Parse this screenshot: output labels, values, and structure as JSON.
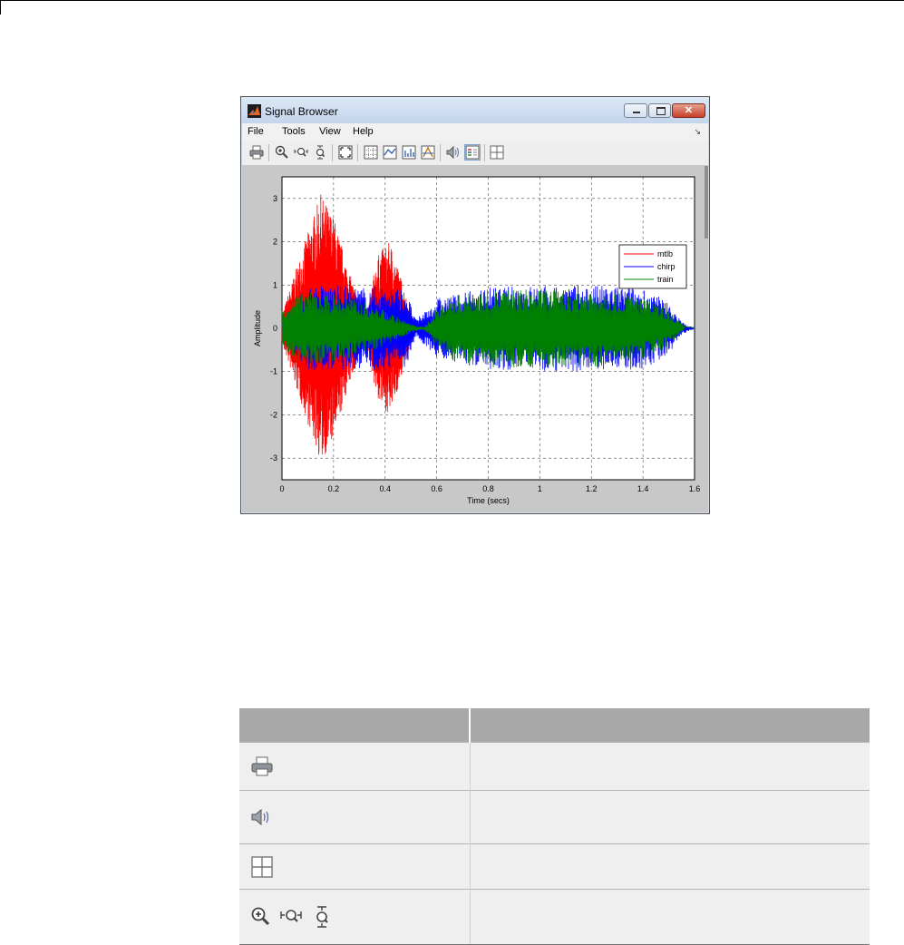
{
  "window": {
    "title": "Signal Browser",
    "menu": [
      "File",
      "Tools",
      "View",
      "Help"
    ],
    "toolbar_icons": [
      "print-icon",
      "zoom-in-icon",
      "zoom-x-icon",
      "zoom-y-icon",
      "autoscale-icon",
      "grid-icon",
      "line-plot-icon",
      "stem-plot-icon",
      "threshold-icon",
      "play-sound-icon",
      "legend-icon",
      "layout-icon"
    ]
  },
  "chart_data": {
    "type": "line",
    "xlabel": "Time (secs)",
    "ylabel": "Amplitude",
    "xlim": [
      0,
      1.6
    ],
    "ylim": [
      -3.5,
      3.5
    ],
    "xticks": [
      "0",
      "0.2",
      "0.4",
      "0.6",
      "0.8",
      "1",
      "1.2",
      "1.4",
      "1.6"
    ],
    "yticks": [
      "-3",
      "-2",
      "-1",
      "0",
      "1",
      "2",
      "3"
    ],
    "grid": true,
    "legend_position": "top-right",
    "series": [
      {
        "name": "mtlb",
        "color": "#ff0000",
        "envelope": [
          [
            0,
            0.3
          ],
          [
            0.05,
            1.3
          ],
          [
            0.1,
            2.2
          ],
          [
            0.15,
            3.1
          ],
          [
            0.2,
            2.6
          ],
          [
            0.25,
            1.5
          ],
          [
            0.3,
            0.6
          ],
          [
            0.33,
            0.3
          ],
          [
            0.36,
            1.4
          ],
          [
            0.38,
            1.8
          ],
          [
            0.42,
            2.0
          ],
          [
            0.44,
            1.6
          ],
          [
            0.47,
            1.0
          ],
          [
            0.5,
            0.3
          ],
          [
            0.52,
            0.1
          ],
          [
            0.55,
            0
          ]
        ]
      },
      {
        "name": "chirp",
        "color": "#0000ff",
        "envelope": [
          [
            0,
            0.2
          ],
          [
            0.1,
            1.0
          ],
          [
            0.2,
            1.0
          ],
          [
            0.3,
            0.95
          ],
          [
            0.4,
            1.0
          ],
          [
            0.48,
            0.9
          ],
          [
            0.52,
            0.2
          ],
          [
            0.6,
            0.7
          ],
          [
            0.8,
            0.95
          ],
          [
            1.0,
            1.0
          ],
          [
            1.2,
            1.0
          ],
          [
            1.4,
            0.95
          ],
          [
            1.5,
            0.6
          ],
          [
            1.55,
            0.15
          ],
          [
            1.6,
            0
          ]
        ]
      },
      {
        "name": "train",
        "color": "#008000",
        "envelope": [
          [
            0,
            0.5
          ],
          [
            0.05,
            0.75
          ],
          [
            0.1,
            0.85
          ],
          [
            0.2,
            0.8
          ],
          [
            0.3,
            0.65
          ],
          [
            0.4,
            0.42
          ],
          [
            0.5,
            0.1
          ],
          [
            0.55,
            0.02
          ],
          [
            0.6,
            0.45
          ],
          [
            0.65,
            0.75
          ],
          [
            0.8,
            0.9
          ],
          [
            1.0,
            0.92
          ],
          [
            1.2,
            0.9
          ],
          [
            1.35,
            0.82
          ],
          [
            1.45,
            0.6
          ],
          [
            1.52,
            0.3
          ],
          [
            1.56,
            0.05
          ]
        ]
      }
    ]
  },
  "table": {
    "headers": [
      "",
      ""
    ],
    "rows": [
      {
        "icons": [
          "print-icon"
        ],
        "desc": ""
      },
      {
        "icons": [
          "speaker-icon"
        ],
        "desc": ""
      },
      {
        "icons": [
          "layout-icon"
        ],
        "desc": ""
      },
      {
        "icons": [
          "zoom-in-icon",
          "zoom-x-icon",
          "zoom-y-icon"
        ],
        "desc": ""
      }
    ]
  }
}
